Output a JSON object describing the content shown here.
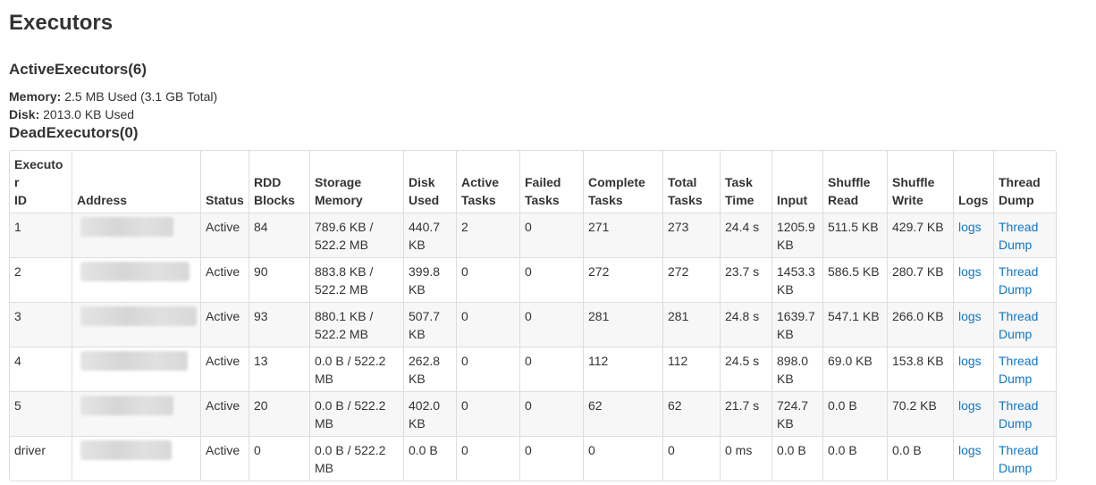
{
  "page": {
    "title": "Executors",
    "active_heading": "ActiveExecutors(6)",
    "memory_label": "Memory:",
    "memory_value": "2.5 MB Used (3.1 GB Total)",
    "disk_label": "Disk:",
    "disk_value": "2013.0 KB Used",
    "dead_heading": "DeadExecutors(0)"
  },
  "table": {
    "headers": {
      "executor_id": [
        "Executor",
        "ID"
      ],
      "address": "Address",
      "status": "Status",
      "rdd_blocks": [
        "RDD",
        "Blocks"
      ],
      "storage_memory": [
        "Storage",
        "Memory"
      ],
      "disk_used": [
        "Disk",
        "Used"
      ],
      "active_tasks": [
        "Active",
        "Tasks"
      ],
      "failed_tasks": [
        "Failed",
        "Tasks"
      ],
      "complete_tasks": [
        "Complete",
        "Tasks"
      ],
      "total_tasks": [
        "Total",
        "Tasks"
      ],
      "task_time": [
        "Task",
        "Time"
      ],
      "input": "Input",
      "shuffle_read": [
        "Shuffle",
        "Read"
      ],
      "shuffle_write": [
        "Shuffle",
        "Write"
      ],
      "logs": "Logs",
      "thread_dump": [
        "Thread",
        "Dump"
      ]
    },
    "rows": [
      {
        "id": "1",
        "status": "Active",
        "rdd": "84",
        "storage": "789.6 KB / 522.2 MB",
        "disk": "440.7 KB",
        "active": "2",
        "failed": "0",
        "complete": "271",
        "total": "273",
        "time": "24.4 s",
        "input": "1205.9 KB",
        "sread": "511.5 KB",
        "swrite": "429.7 KB",
        "logs": "logs",
        "dump": "Thread Dump"
      },
      {
        "id": "2",
        "status": "Active",
        "rdd": "90",
        "storage": "883.8 KB / 522.2 MB",
        "disk": "399.8 KB",
        "active": "0",
        "failed": "0",
        "complete": "272",
        "total": "272",
        "time": "23.7 s",
        "input": "1453.3 KB",
        "sread": "586.5 KB",
        "swrite": "280.7 KB",
        "logs": "logs",
        "dump": "Thread Dump"
      },
      {
        "id": "3",
        "status": "Active",
        "rdd": "93",
        "storage": "880.1 KB / 522.2 MB",
        "disk": "507.7 KB",
        "active": "0",
        "failed": "0",
        "complete": "281",
        "total": "281",
        "time": "24.8 s",
        "input": "1639.7 KB",
        "sread": "547.1 KB",
        "swrite": "266.0 KB",
        "logs": "logs",
        "dump": "Thread Dump"
      },
      {
        "id": "4",
        "status": "Active",
        "rdd": "13",
        "storage": "0.0 B / 522.2 MB",
        "disk": "262.8 KB",
        "active": "0",
        "failed": "0",
        "complete": "112",
        "total": "112",
        "time": "24.5 s",
        "input": "898.0 KB",
        "sread": "69.0 KB",
        "swrite": "153.8 KB",
        "logs": "logs",
        "dump": "Thread Dump"
      },
      {
        "id": "5",
        "status": "Active",
        "rdd": "20",
        "storage": "0.0 B / 522.2 MB",
        "disk": "402.0 KB",
        "active": "0",
        "failed": "0",
        "complete": "62",
        "total": "62",
        "time": "21.7 s",
        "input": "724.7 KB",
        "sread": "0.0 B",
        "swrite": "70.2 KB",
        "logs": "logs",
        "dump": "Thread Dump"
      },
      {
        "id": "driver",
        "status": "Active",
        "rdd": "0",
        "storage": "0.0 B / 522.2 MB",
        "disk": "0.0 B",
        "active": "0",
        "failed": "0",
        "complete": "0",
        "total": "0",
        "time": "0 ms",
        "input": "0.0 B",
        "sread": "0.0 B",
        "swrite": "0.0 B",
        "logs": "logs",
        "dump": "Thread Dump"
      }
    ]
  },
  "colors": {
    "link": "#0f76c8",
    "text": "#333333",
    "border": "#dddddd",
    "stripe": "#f7f7f7"
  }
}
